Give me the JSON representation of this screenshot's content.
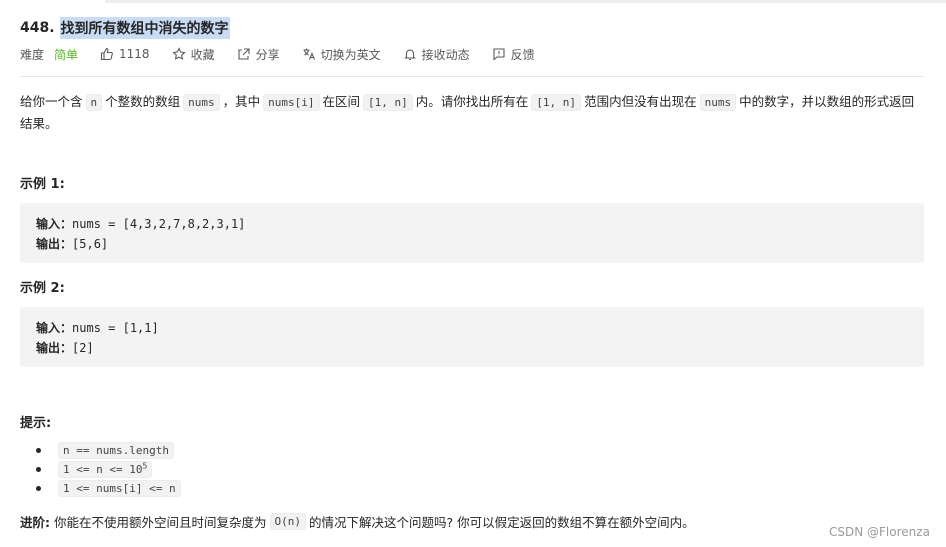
{
  "problem": {
    "number": "448.",
    "title": "找到所有数组中消失的数字"
  },
  "meta": {
    "difficulty_label": "难度",
    "difficulty": "简单",
    "likes": "1118",
    "favorite": "收藏",
    "share": "分享",
    "translate": "切换为英文",
    "notify": "接收动态",
    "feedback": "反馈",
    "colors": {
      "easy": "#5ab726"
    }
  },
  "description": {
    "t1": "给你一个含",
    "c1": "n",
    "t2": "个整数的数组",
    "c2": "nums",
    "t3": "，其中",
    "c3": "nums[i]",
    "t4": "在区间",
    "c4": "[1, n]",
    "t5": "内。请你找出所有在",
    "c5": "[1, n]",
    "t6": "范围内但没有出现在",
    "c6": "nums",
    "t7": "中的数字，并以数组的形式返回结果。"
  },
  "examples": [
    {
      "heading": "示例 1:",
      "input_label": "输入：",
      "input": "nums = [4,3,2,7,8,2,3,1]",
      "output_label": "输出：",
      "output": "[5,6]"
    },
    {
      "heading": "示例 2:",
      "input_label": "输入：",
      "input": "nums = [1,1]",
      "output_label": "输出：",
      "output": "[2]"
    }
  ],
  "hints": {
    "heading": "提示:",
    "items": [
      {
        "text": "n == nums.length"
      },
      {
        "text": "1 <= n <= 10",
        "sup": "5"
      },
      {
        "text": "1 <= nums[i] <= n"
      }
    ]
  },
  "advanced": {
    "label": "进阶:",
    "t1": "你能在不使用额外空间且时间复杂度为",
    "code": "O(n)",
    "t2": "的情况下解决这个问题吗? 你可以假定返回的数组不算在额外空间内。"
  },
  "watermark": "CSDN @Florenza",
  "icons": [
    "thumbs-up-icon",
    "star-icon",
    "share-icon",
    "translate-icon",
    "bell-icon",
    "feedback-icon"
  ]
}
